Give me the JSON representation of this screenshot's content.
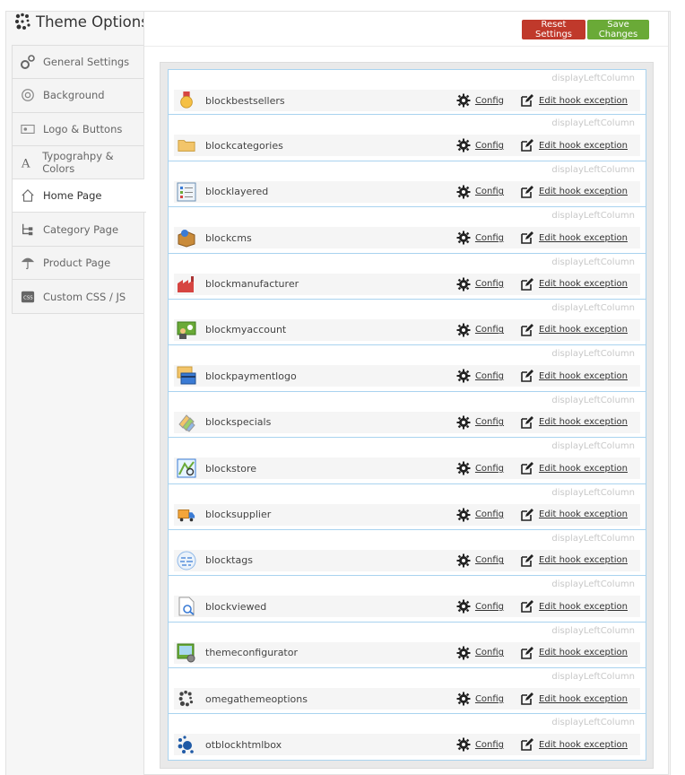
{
  "header": {
    "title": "Theme Options"
  },
  "buttons": {
    "reset": "Reset Settings",
    "save": "Save Changes"
  },
  "sidebar": {
    "items": [
      {
        "label": "General Settings",
        "icon": "gears-icon",
        "active": false
      },
      {
        "label": "Background",
        "icon": "background-icon",
        "active": false
      },
      {
        "label": "Logo & Buttons",
        "icon": "logo-buttons-icon",
        "active": false
      },
      {
        "label": "Typograhpy & Colors",
        "icon": "typography-icon",
        "active": false
      },
      {
        "label": "Home Page",
        "icon": "home-icon",
        "active": true
      },
      {
        "label": "Category Page",
        "icon": "category-tree-icon",
        "active": false
      },
      {
        "label": "Product Page",
        "icon": "umbrella-icon",
        "active": false
      },
      {
        "label": "Custom CSS / JS",
        "icon": "css-icon",
        "active": false
      }
    ]
  },
  "modules": {
    "hook_label": "displayLeftColumn",
    "config_label": "Config",
    "edit_label": "Edit hook exception",
    "items": [
      {
        "name": "blockbestsellers",
        "icon": "medal-icon"
      },
      {
        "name": "blockcategories",
        "icon": "folder-icon"
      },
      {
        "name": "blocklayered",
        "icon": "layered-list-icon"
      },
      {
        "name": "blockcms",
        "icon": "cms-box-icon"
      },
      {
        "name": "blockmanufacturer",
        "icon": "factory-icon"
      },
      {
        "name": "blockmyaccount",
        "icon": "account-icon"
      },
      {
        "name": "blockpaymentlogo",
        "icon": "payment-card-icon"
      },
      {
        "name": "blockspecials",
        "icon": "specials-tags-icon"
      },
      {
        "name": "blockstore",
        "icon": "store-map-icon"
      },
      {
        "name": "blocksupplier",
        "icon": "truck-icon"
      },
      {
        "name": "blocktags",
        "icon": "tags-cloud-icon"
      },
      {
        "name": "blockviewed",
        "icon": "viewed-page-icon"
      },
      {
        "name": "themeconfigurator",
        "icon": "theme-config-icon"
      },
      {
        "name": "omegathemeoptions",
        "icon": "omega-logo-icon"
      },
      {
        "name": "otblockhtmlbox",
        "icon": "dots-logo-icon"
      }
    ]
  }
}
